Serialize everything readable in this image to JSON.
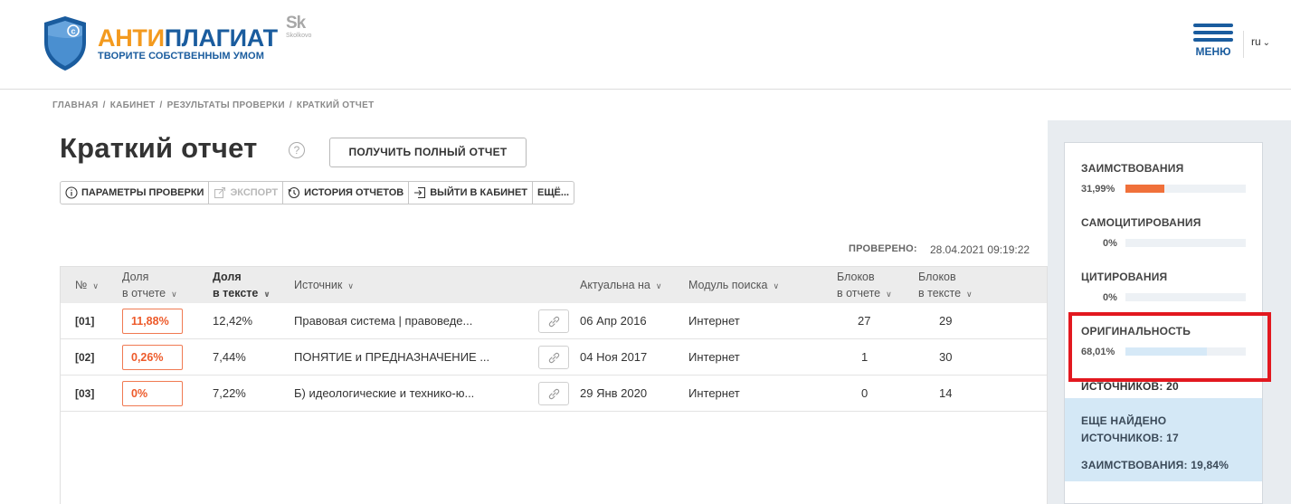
{
  "header": {
    "brand_part1": "АНТИ",
    "brand_part2": "ПЛАГИАТ",
    "tagline": "ТВОРИТЕ СОБСТВЕННЫМ УМОМ",
    "partner_big": "Sk",
    "partner_small": "Skolkovo",
    "menu_label": "МЕНЮ",
    "lang": "ru",
    "brand_orange": "#f39a1e",
    "brand_blue": "#1a5c9e"
  },
  "breadcrumb": [
    "ГЛАВНАЯ",
    "КАБИНЕТ",
    "РЕЗУЛЬТАТЫ ПРОВЕРКИ",
    "КРАТКИЙ ОТЧЕТ"
  ],
  "page": {
    "title": "Краткий отчет",
    "full_report_btn": "ПОЛУЧИТЬ ПОЛНЫЙ ОТЧЕТ",
    "checked_label": "ПРОВЕРЕНО:",
    "checked_value": "28.04.2021 09:19:22"
  },
  "toolbar": {
    "params": "ПАРАМЕТРЫ ПРОВЕРКИ",
    "export": "ЭКСПОРТ",
    "history": "ИСТОРИЯ ОТЧЕТОВ",
    "exit": "ВЫЙТИ В КАБИНЕТ",
    "more": "ЕЩЁ..."
  },
  "table": {
    "headers": {
      "num": "№",
      "share_report_1": "Доля",
      "share_report_2": "в отчете",
      "share_text_1": "Доля",
      "share_text_2": "в тексте",
      "source": "Источник",
      "actual": "Актуальна на",
      "module": "Модуль поиска",
      "blocks_report_1": "Блоков",
      "blocks_report_2": "в отчете",
      "blocks_text_1": "Блоков",
      "blocks_text_2": "в тексте"
    },
    "rows": [
      {
        "num": "[01]",
        "share_report": "11,88%",
        "share_text": "12,42%",
        "source": "Правовая система | правоведе...",
        "date": "06 Апр 2016",
        "module": "Интернет",
        "blocks_report": "27",
        "blocks_text": "29"
      },
      {
        "num": "[02]",
        "share_report": "0,26%",
        "share_text": "7,44%",
        "source": "ПОНЯТИЕ и ПРЕДНАЗНАЧЕНИЕ ...",
        "date": "04 Ноя 2017",
        "module": "Интернет",
        "blocks_report": "1",
        "blocks_text": "30"
      },
      {
        "num": "[03]",
        "share_report": "0%",
        "share_text": "7,22%",
        "source": "Б) идеологические и технико-ю...",
        "date": "29 Янв 2020",
        "module": "Интернет",
        "blocks_report": "0",
        "blocks_text": "14"
      }
    ]
  },
  "sidebar": {
    "borrowings_label": "ЗАИМСТВОВАНИЯ",
    "borrowings_value": "31,99%",
    "borrowings_fraction": 0.3199,
    "borrowings_color": "#f0703a",
    "selfcite_label": "САМОЦИТИРОВАНИЯ",
    "selfcite_value": "0%",
    "cite_label": "ЦИТИРОВАНИЯ",
    "cite_value": "0%",
    "originality_label": "ОРИГИНАЛЬНОСТЬ",
    "originality_value": "68,01%",
    "originality_fraction": 0.6801,
    "originality_color": "#d6e9f7",
    "sources_label": "ИСТОЧНИКОВ:",
    "sources_value": "20",
    "more_found_line1": "ЕЩЕ НАЙДЕНО",
    "more_found_line2": "ИСТОЧНИКОВ:",
    "more_found_value": "17",
    "more_borrow_label": "ЗАИМСТВОВАНИЯ:",
    "more_borrow_value": "19,84%",
    "highlight_color": "#e2181f"
  }
}
